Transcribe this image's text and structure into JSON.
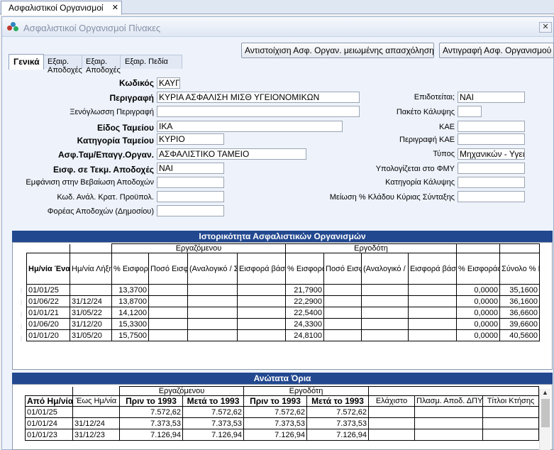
{
  "doc_tab": {
    "label": "Ασφαλιστικοί Οργανισμοί",
    "close": "✕"
  },
  "window": {
    "title": "Ασφαλιστικοί Οργανισμοί Πίνακες",
    "close": "✕"
  },
  "toolbar": {
    "btn_match": "Αντιστοίχιση Ασφ. Οργαν. μειωμένης απασχόλησης",
    "btn_copy": "Αντιγραφή Ασφ. Οργανισμού"
  },
  "tabs": [
    "Γενικά",
    "Εξαιρ. Αποδοχές",
    "Εξαιρ. Πεδία"
  ],
  "form_left": [
    {
      "label": "Κωδικός",
      "value": "ΚΑΥΓ"
    },
    {
      "label": "Περιγραφή",
      "value": "ΚΥΡΙΑ ΑΣΦΑΛΙΣΗ ΜΙΣΘ ΥΓΕΙΟΝΟΜΙΚΩΝ"
    },
    {
      "label": "Ξενόγλωσση Περιγραφή",
      "value": ""
    },
    {
      "label": "Είδος Ταμείου",
      "value": "ΙΚΑ"
    },
    {
      "label": "Κατηγορία Ταμείου",
      "value": "ΚΥΡΙΟ"
    },
    {
      "label": "Ασφ.Ταμ/Επαγγ.Οργαν.",
      "value": "ΑΣΦΑΛΙΣΤΙΚΟ ΤΑΜΕΙΟ"
    },
    {
      "label": "Εισφ. σε Τεκμ. Αποδοχές",
      "value": "ΝΑΙ"
    },
    {
      "label": "Εμφάνιση στην Βεβαίωση Αποδοχών",
      "value": ""
    },
    {
      "label": "Κωδ. Ανάλ. Κρατ. Προϋπολ.",
      "value": ""
    },
    {
      "label": "Φορέας Αποδοχών (Δημοσίου)",
      "value": ""
    }
  ],
  "form_right": [
    {
      "label": "Επιδοτείται;",
      "value": "ΝΑΙ"
    },
    {
      "label": "Πακέτο Κάλυψης",
      "value": ""
    },
    {
      "label": "ΚΑΕ",
      "value": ""
    },
    {
      "label": "Περιγραφή ΚΑΕ",
      "value": ""
    },
    {
      "label": "Τύπος",
      "value": "Μηχανικών - Υγειο"
    },
    {
      "label": "Υπολογίζεται στο ΦΜΥ",
      "value": ""
    },
    {
      "label": "Κατηγορία Κάλυψης",
      "value": ""
    },
    {
      "label": "Μείωση % Κλάδου Κύριας Σύνταξης",
      "value": ""
    }
  ],
  "history": {
    "title": "Ιστορικότητα Ασφαλιστικών Οργανισμών",
    "group_employee": "Εργαζόμενου",
    "group_employer": "Εργοδότη",
    "cols": [
      "Ημ/νία Έναρξης",
      "Ημ/νία Λήξης",
      "% Εισφορών",
      "Ποσό Εισφορών",
      "(Αναλογικό / Σταθερό)",
      "Εισφορά βάσει πεδίου",
      "% Εισφορών",
      "Ποσό Εισφορών",
      "(Αναλογικό / Σταθερό)",
      "Εισφορά βάσει πεδίου",
      "% Εισφοράς υπέρ ΛΑΕΚ",
      "Σύνολο % Εισφορών"
    ],
    "rows": [
      [
        "01/01/25",
        "",
        "13,3700",
        "",
        "",
        "",
        "21,7900",
        "",
        "",
        "",
        "0,0000",
        "35,1600"
      ],
      [
        "01/06/22",
        "31/12/24",
        "13,8700",
        "",
        "",
        "",
        "22,2900",
        "",
        "",
        "",
        "0,0000",
        "36,1600"
      ],
      [
        "01/01/21",
        "31/05/22",
        "14,1200",
        "",
        "",
        "",
        "22,5400",
        "",
        "",
        "",
        "0,0000",
        "36,6600"
      ],
      [
        "01/06/20",
        "31/12/20",
        "15,3300",
        "",
        "",
        "",
        "24,3300",
        "",
        "",
        "",
        "0,0000",
        "39,6600"
      ],
      [
        "01/01/20",
        "31/05/20",
        "15,7500",
        "",
        "",
        "",
        "24,8100",
        "",
        "",
        "",
        "0,0000",
        "40,5600"
      ]
    ]
  },
  "limits": {
    "title": "Ανώτατα Όρια",
    "group_employee": "Εργαζόμενου",
    "group_employer": "Εργοδότη",
    "cols": [
      "Από Ημ/νία",
      "Έως Ημ/νία",
      "Πριν το 1993",
      "Μετά το 1993",
      "Πριν το 1993",
      "Μετά το 1993",
      "Ελάχιστο",
      "Πλασμ. Αποδ. ΔΠΥ",
      "Τίτλοι Κτήσης"
    ],
    "rows": [
      [
        "01/01/25",
        "",
        "7.572,62",
        "7.572,62",
        "7.572,62",
        "7.572,62",
        "",
        "",
        ""
      ],
      [
        "01/01/24",
        "31/12/24",
        "7.373,53",
        "7.373,53",
        "7.373,53",
        "7.373,53",
        "",
        "",
        ""
      ],
      [
        "01/01/23",
        "31/12/23",
        "7.126,94",
        "7.126,94",
        "7.126,94",
        "7.126,94",
        "",
        "",
        ""
      ]
    ]
  }
}
